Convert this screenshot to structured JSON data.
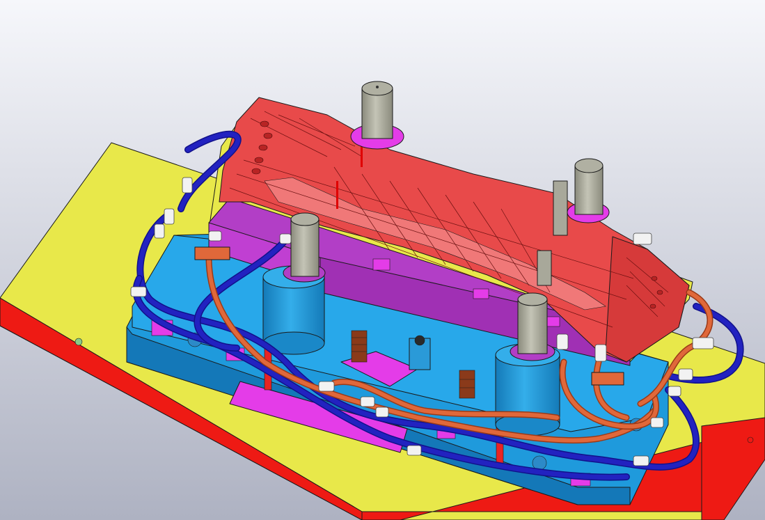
{
  "viewport": {
    "background_top": "#f6f7fb",
    "background_bottom": "#aeb2c2"
  },
  "colors": {
    "base_plate_top": "#e8e84a",
    "base_plate_side": "#ee1a14",
    "lower_die_blue": "#24a4e6",
    "lower_die_blue_dark": "#1478b8",
    "ejector_magenta": "#e43ce8",
    "upper_die_purple": "#b23ec6",
    "upper_die_magenta": "#c03fd2",
    "punch_red": "#e84a4a",
    "punch_red_dark": "#b82424",
    "guide_post_gray": "#a8a89a",
    "hose_blue": "#2222c0",
    "hose_orange": "#e0683a",
    "fitting_white": "#f2f2f2",
    "spring_brown": "#8a3a1a"
  },
  "icons": {
    "guide_posts": "cylinder-icon",
    "springs": "coil-spring-icon",
    "fittings": "hose-fitting-icon"
  }
}
